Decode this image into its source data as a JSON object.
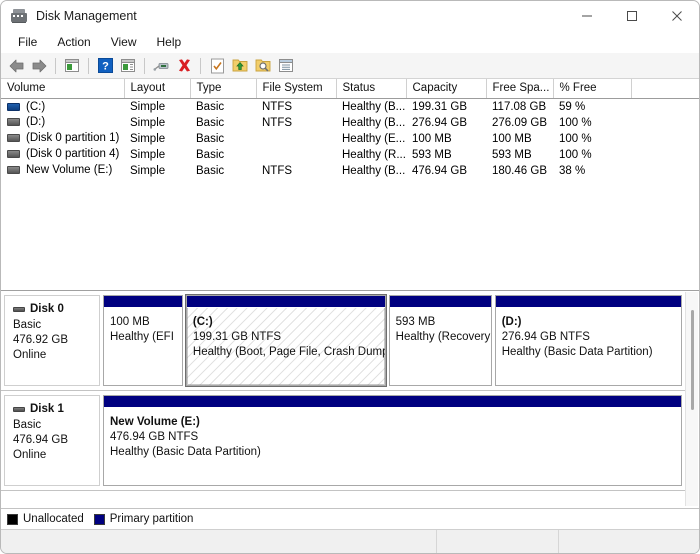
{
  "window": {
    "title": "Disk Management",
    "icon": "disk-management-icon",
    "controls": {
      "minimize": "minimize-icon",
      "maximize": "maximize-icon",
      "close": "close-icon"
    }
  },
  "menubar": {
    "items": [
      {
        "label": "File"
      },
      {
        "label": "Action"
      },
      {
        "label": "View"
      },
      {
        "label": "Help"
      }
    ]
  },
  "toolbar": {
    "buttons": [
      {
        "name": "back-arrow-icon"
      },
      {
        "name": "forward-arrow-icon"
      },
      {
        "name": "up-one-level-icon"
      },
      {
        "name": "help-icon"
      },
      {
        "name": "show-hide-console-tree-icon"
      },
      {
        "name": "rescan-disks-icon"
      },
      {
        "name": "delete-volume-icon"
      },
      {
        "name": "properties-icon"
      },
      {
        "name": "extend-volume-icon"
      },
      {
        "name": "search-volume-icon"
      },
      {
        "name": "all-tasks-icon"
      }
    ]
  },
  "volume_list": {
    "columns": [
      "Volume",
      "Layout",
      "Type",
      "File System",
      "Status",
      "Capacity",
      "Free Spa...",
      "% Free"
    ],
    "rows": [
      {
        "icon": "blue",
        "volume": "(C:)",
        "layout": "Simple",
        "type": "Basic",
        "file_system": "NTFS",
        "status": "Healthy (B...",
        "capacity": "199.31 GB",
        "free_space": "117.08 GB",
        "percent_free": "59 %"
      },
      {
        "icon": "gray",
        "volume": "(D:)",
        "layout": "Simple",
        "type": "Basic",
        "file_system": "NTFS",
        "status": "Healthy (B...",
        "capacity": "276.94 GB",
        "free_space": "276.09 GB",
        "percent_free": "100 %"
      },
      {
        "icon": "gray",
        "volume": "(Disk 0 partition 1)",
        "layout": "Simple",
        "type": "Basic",
        "file_system": "",
        "status": "Healthy (E...",
        "capacity": "100 MB",
        "free_space": "100 MB",
        "percent_free": "100 %"
      },
      {
        "icon": "gray",
        "volume": "(Disk 0 partition 4)",
        "layout": "Simple",
        "type": "Basic",
        "file_system": "",
        "status": "Healthy (R...",
        "capacity": "593 MB",
        "free_space": "593 MB",
        "percent_free": "100 %"
      },
      {
        "icon": "gray",
        "volume": "New Volume (E:)",
        "layout": "Simple",
        "type": "Basic",
        "file_system": "NTFS",
        "status": "Healthy (B...",
        "capacity": "476.94 GB",
        "free_space": "180.46 GB",
        "percent_free": "38 %"
      }
    ]
  },
  "disks": [
    {
      "name": "Disk 0",
      "type": "Basic",
      "size": "476.92 GB",
      "state": "Online",
      "partitions": [
        {
          "label": "",
          "size_fs": "100 MB",
          "status": "Healthy (EFI",
          "bar": "primary",
          "selected": false,
          "width_pct": 13.8
        },
        {
          "label": "(C:)",
          "size_fs": "199.31 GB NTFS",
          "status": "Healthy (Boot, Page File, Crash Dump",
          "bar": "primary",
          "selected": true,
          "width_pct": 34.5
        },
        {
          "label": "",
          "size_fs": "593 MB",
          "status": "Healthy (Recovery",
          "bar": "primary",
          "selected": false,
          "width_pct": 17.8
        },
        {
          "label": "(D:)",
          "size_fs": "276.94 GB NTFS",
          "status": "Healthy (Basic Data Partition)",
          "bar": "primary",
          "selected": false,
          "width_pct": 33.9
        }
      ]
    },
    {
      "name": "Disk 1",
      "type": "Basic",
      "size": "476.94 GB",
      "state": "Online",
      "partitions": [
        {
          "label": "New Volume  (E:)",
          "size_fs": "476.94 GB NTFS",
          "status": "Healthy (Basic Data Partition)",
          "bar": "primary",
          "selected": false,
          "width_pct": 100
        }
      ]
    }
  ],
  "legend": {
    "entries": [
      {
        "label": "Unallocated",
        "color": "#000000"
      },
      {
        "label": "Primary partition",
        "color": "#000080"
      }
    ]
  },
  "statusbar": {
    "cells": [
      "",
      "",
      ""
    ]
  },
  "colors": {
    "primary_partition": "#000080",
    "unallocated": "#000000",
    "selected_volume_icon": "#1f5fad"
  }
}
